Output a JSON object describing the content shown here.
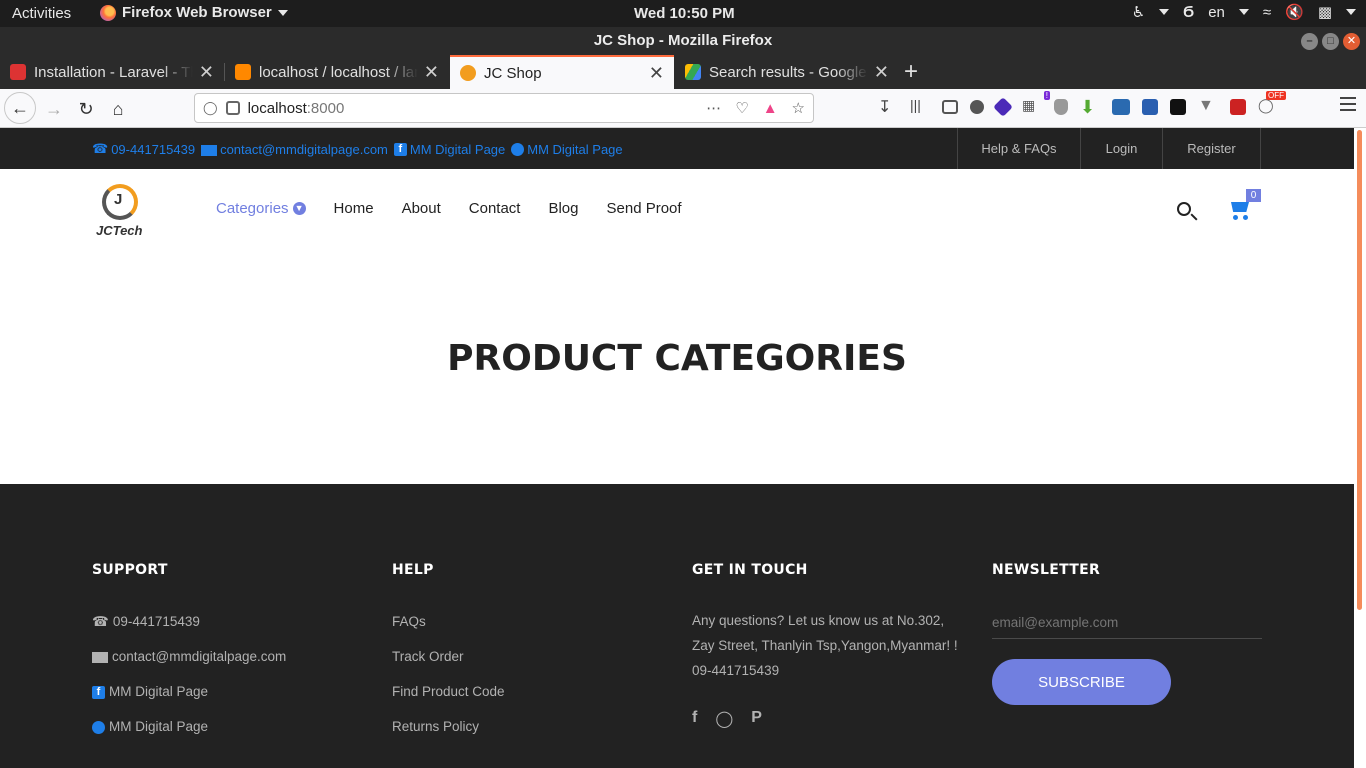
{
  "gnome": {
    "activities": "Activities",
    "app_name": "Firefox Web Browser",
    "clock": "Wed 10:50 PM",
    "lang": "en"
  },
  "window": {
    "title": "JC Shop - Mozilla Firefox"
  },
  "tabs": [
    {
      "title": "Installation - Laravel - The PHP Framework",
      "favicon_color": "#d33",
      "active": false
    },
    {
      "title": "localhost / localhost / laravel",
      "favicon_color": "#f80",
      "active": false
    },
    {
      "title": "JC Shop",
      "favicon_color": "#f29d1f",
      "active": true
    },
    {
      "title": "Search results - Google Drive",
      "favicon_color": "#34a853",
      "active": false
    }
  ],
  "urlbar": {
    "host": "localhost",
    "port": ":8000"
  },
  "page": {
    "topbar": {
      "phone": "09-441715439",
      "email": "contact@mmdigitalpage.com",
      "facebook": "MM Digital Page",
      "messenger": "MM Digital Page",
      "links": [
        "Help & FAQs",
        "Login",
        "Register"
      ]
    },
    "logo_text": "JCTech",
    "logo_letter": "J",
    "menu": {
      "categories": "Categories",
      "items": [
        "Home",
        "About",
        "Contact",
        "Blog",
        "Send Proof"
      ]
    },
    "cart_count": "0",
    "hero_title": "PRODUCT CATEGORIES",
    "footer": {
      "support": {
        "heading": "SUPPORT",
        "phone": "09-441715439",
        "email": "contact@mmdigitalpage.com",
        "facebook": "MM Digital Page",
        "messenger": "MM Digital Page"
      },
      "help": {
        "heading": "HELP",
        "items": [
          "FAQs",
          "Track Order",
          "Find Product Code",
          "Returns Policy"
        ]
      },
      "contact": {
        "heading": "GET IN TOUCH",
        "text": "Any questions? Let us know us at No.302, Zay Street, Thanlyin Tsp,Yangon,Myanmar! ! 09-441715439"
      },
      "newsletter": {
        "heading": "NEWSLETTER",
        "placeholder": "email@example.com",
        "button": "SUBSCRIBE"
      }
    }
  },
  "colors": {
    "accent": "#717fe0",
    "link_blue": "#1e7ee8",
    "dark_bg": "#222222",
    "tab_highlight": "#ff6b3d"
  }
}
